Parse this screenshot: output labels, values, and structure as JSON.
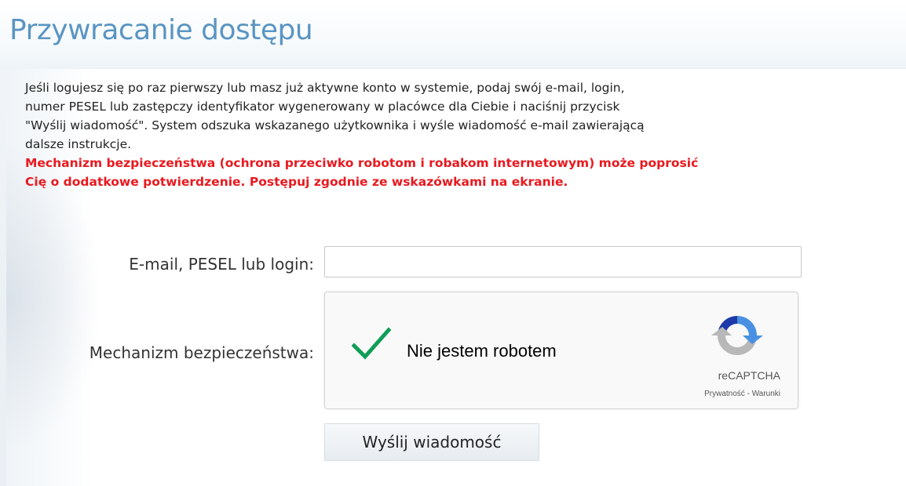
{
  "page": {
    "title": "Przywracanie dostępu"
  },
  "intro": {
    "lines": [
      "Jeśli logujesz się po raz pierwszy lub masz już aktywne konto w systemie, podaj swój e-mail, login,",
      "numer PESEL lub zastępczy identyfikator wygenerowany w placówce dla Ciebie i naciśnij przycisk",
      "\"Wyślij wiadomość\". System odszuka wskazanego użytkownika i wyśle wiadomość e-mail zawierającą",
      "dalsze instrukcje."
    ]
  },
  "warning": {
    "lines": [
      "Mechanizm bezpieczeństwa (ochrona przeciwko robotom i robakom internetowym) może poprosić",
      "Cię o dodatkowe potwierdzenie. Postępuj zgodnie ze wskazówkami na ekranie."
    ],
    "color": "#e8191f"
  },
  "form": {
    "email_label": "E-mail, PESEL lub login:",
    "email_value": "",
    "email_placeholder": "",
    "security_label": "Mechanizm bezpieczeństwa:",
    "submit_label": "Wyślij wiadomość"
  },
  "captcha": {
    "label": "Nie jestem robotem",
    "checked": true,
    "check_icon": "checkmark-icon",
    "logo_icon": "recaptcha-logo-icon",
    "brand": "reCAPTCHA",
    "privacy_link": "Prywatność",
    "separator": " - ",
    "terms_link": "Warunki",
    "check_color": "#109d58"
  },
  "colors": {
    "title": "#5a95c3",
    "text": "#222222"
  }
}
